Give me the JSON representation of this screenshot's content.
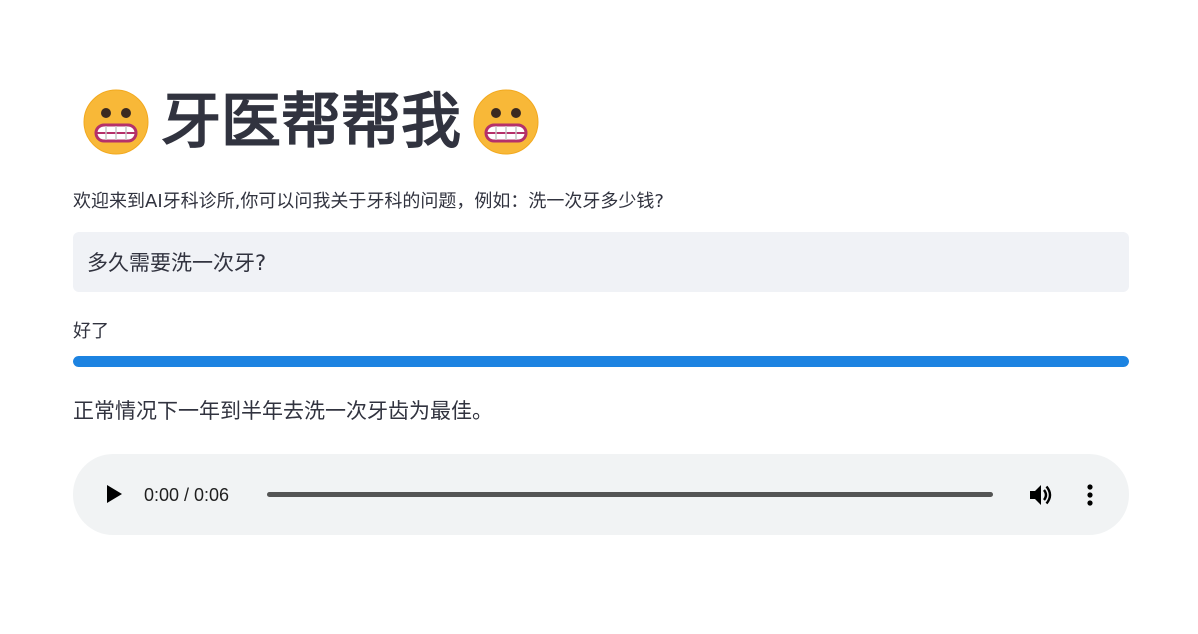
{
  "header": {
    "title": "牙医帮帮我",
    "left_icon": "grimacing-face-emoji",
    "right_icon": "grimacing-face-emoji"
  },
  "intro_text": "欢迎来到AI牙科诊所,你可以问我关于牙科的问题，例如：洗一次牙多少钱?",
  "question_input": {
    "value": "多久需要洗一次牙?"
  },
  "status": {
    "text": "好了",
    "progress": 1.0
  },
  "answer_text": "正常情况下一年到半年去洗一次牙齿为最佳。",
  "audio_player": {
    "time_display": "0:00 / 0:06",
    "play_icon": "play-icon",
    "volume_icon": "volume-icon",
    "more_icon": "more-options-icon",
    "progress": 0
  },
  "colors": {
    "accent": "#1c83e1",
    "text": "#31333f",
    "input_bg": "#f0f2f6",
    "audio_bg": "#f1f3f4",
    "emoji_face": "#f8b838"
  }
}
